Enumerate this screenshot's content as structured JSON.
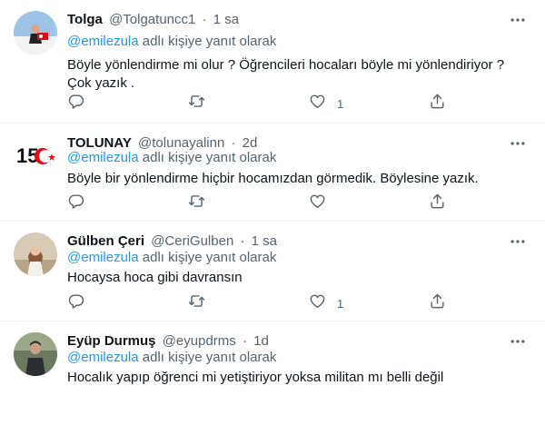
{
  "reply_prefix": "@emilezula",
  "reply_suffix": "adlı kişiye yanıt olarak",
  "tweets": [
    {
      "name": "Tolga",
      "handle": "@Tolgatuncc1",
      "sep": "·",
      "time": "1 sa",
      "text": "Böyle yönlendirme mi olur ? Öğrencileri hocaları böyle mi yönlendiriyor ? Çok yazık .",
      "likes": "1"
    },
    {
      "name": "TOLUNAY",
      "handle": "@tolunayalinn",
      "sep": "·",
      "time": "2d",
      "text": "Böyle bir yönlendirme hiçbir hocamızdan görmedik. Böylesine yazık.",
      "likes": ""
    },
    {
      "name": "Gülben Çeri",
      "handle": "@CeriGulben",
      "sep": "·",
      "time": "1 sa",
      "text": "Hocaysa hoca gibi davransın",
      "likes": "1"
    },
    {
      "name": "Eyüp Durmuş",
      "handle": "@eyupdrms",
      "sep": "·",
      "time": "1d",
      "text": "Hocalık yapıp öğrenci mi yetiştiriyor yoksa militan mı belli değil",
      "likes": ""
    }
  ],
  "avatar_logo_text": "15",
  "icons": [
    "more-icon",
    "reply-icon",
    "retweet-icon",
    "like-icon",
    "share-icon"
  ],
  "colors": {
    "accent": "#1d9bf0",
    "muted": "#536471",
    "text": "#0f1419",
    "divider": "#eff3f4",
    "logo_red": "#e30a17"
  }
}
